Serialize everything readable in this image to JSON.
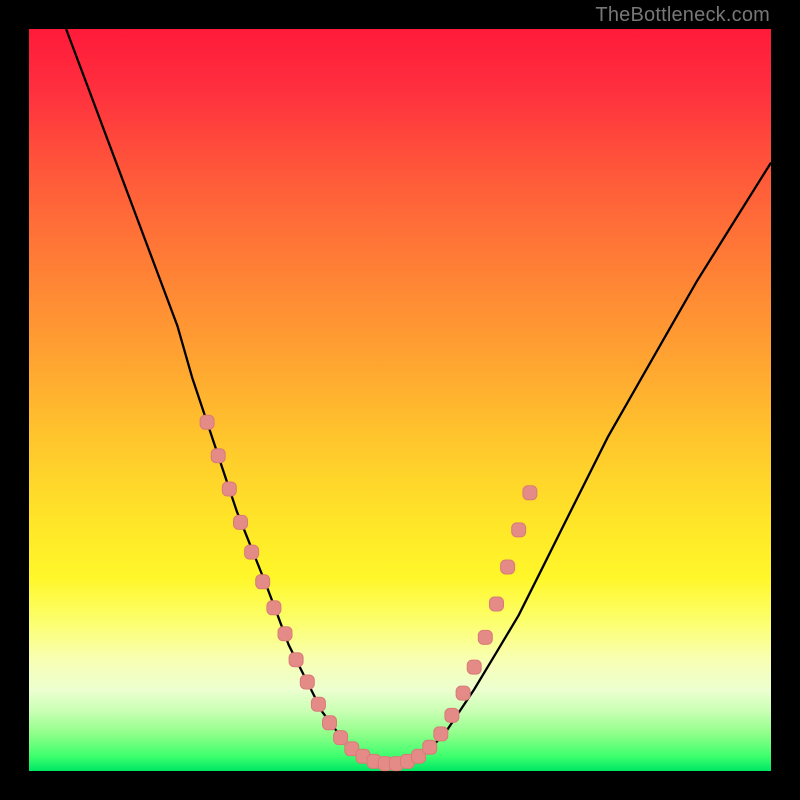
{
  "watermark": "TheBottleneck.com",
  "colors": {
    "curve_stroke": "#000000",
    "marker_fill": "#e58b87",
    "marker_stroke": "#d87b77",
    "background_frame": "#000000"
  },
  "chart_data": {
    "type": "line",
    "title": "",
    "xlabel": "",
    "ylabel": "",
    "xlim": [
      0,
      100
    ],
    "ylim": [
      0,
      100
    ],
    "series": [
      {
        "name": "bottleneck-curve",
        "x": [
          5,
          8,
          11,
          14,
          17,
          20,
          22,
          24,
          26,
          28,
          30,
          32,
          33.5,
          35,
          36.5,
          38,
          39.5,
          41,
          42.5,
          44,
          46,
          48,
          50,
          52,
          54,
          56,
          58,
          60,
          63,
          66,
          69,
          72,
          75,
          78,
          82,
          86,
          90,
          95,
          100
        ],
        "y": [
          100,
          92,
          84,
          76,
          68,
          60,
          53,
          47,
          41,
          35,
          30,
          25,
          21,
          17,
          14,
          11,
          8,
          6,
          4,
          2.5,
          1.5,
          1,
          1,
          1.5,
          3,
          5,
          8,
          11,
          16,
          21,
          27,
          33,
          39,
          45,
          52,
          59,
          66,
          74,
          82
        ]
      }
    ],
    "markers": {
      "name": "bottleneck-highlight-dots",
      "points": [
        {
          "x": 24,
          "y": 47
        },
        {
          "x": 25.5,
          "y": 42.5
        },
        {
          "x": 27,
          "y": 38
        },
        {
          "x": 28.5,
          "y": 33.5
        },
        {
          "x": 30,
          "y": 29.5
        },
        {
          "x": 31.5,
          "y": 25.5
        },
        {
          "x": 33,
          "y": 22
        },
        {
          "x": 34.5,
          "y": 18.5
        },
        {
          "x": 36,
          "y": 15
        },
        {
          "x": 37.5,
          "y": 12
        },
        {
          "x": 39,
          "y": 9
        },
        {
          "x": 40.5,
          "y": 6.5
        },
        {
          "x": 42,
          "y": 4.5
        },
        {
          "x": 43.5,
          "y": 3
        },
        {
          "x": 45,
          "y": 2
        },
        {
          "x": 46.5,
          "y": 1.3
        },
        {
          "x": 48,
          "y": 1
        },
        {
          "x": 49.5,
          "y": 1
        },
        {
          "x": 51,
          "y": 1.3
        },
        {
          "x": 52.5,
          "y": 2
        },
        {
          "x": 54,
          "y": 3.2
        },
        {
          "x": 55.5,
          "y": 5
        },
        {
          "x": 57,
          "y": 7.5
        },
        {
          "x": 58.5,
          "y": 10.5
        },
        {
          "x": 60,
          "y": 14
        },
        {
          "x": 61.5,
          "y": 18
        },
        {
          "x": 63,
          "y": 22.5
        },
        {
          "x": 64.5,
          "y": 27.5
        },
        {
          "x": 66,
          "y": 32.5
        },
        {
          "x": 67.5,
          "y": 37.5
        }
      ]
    }
  }
}
